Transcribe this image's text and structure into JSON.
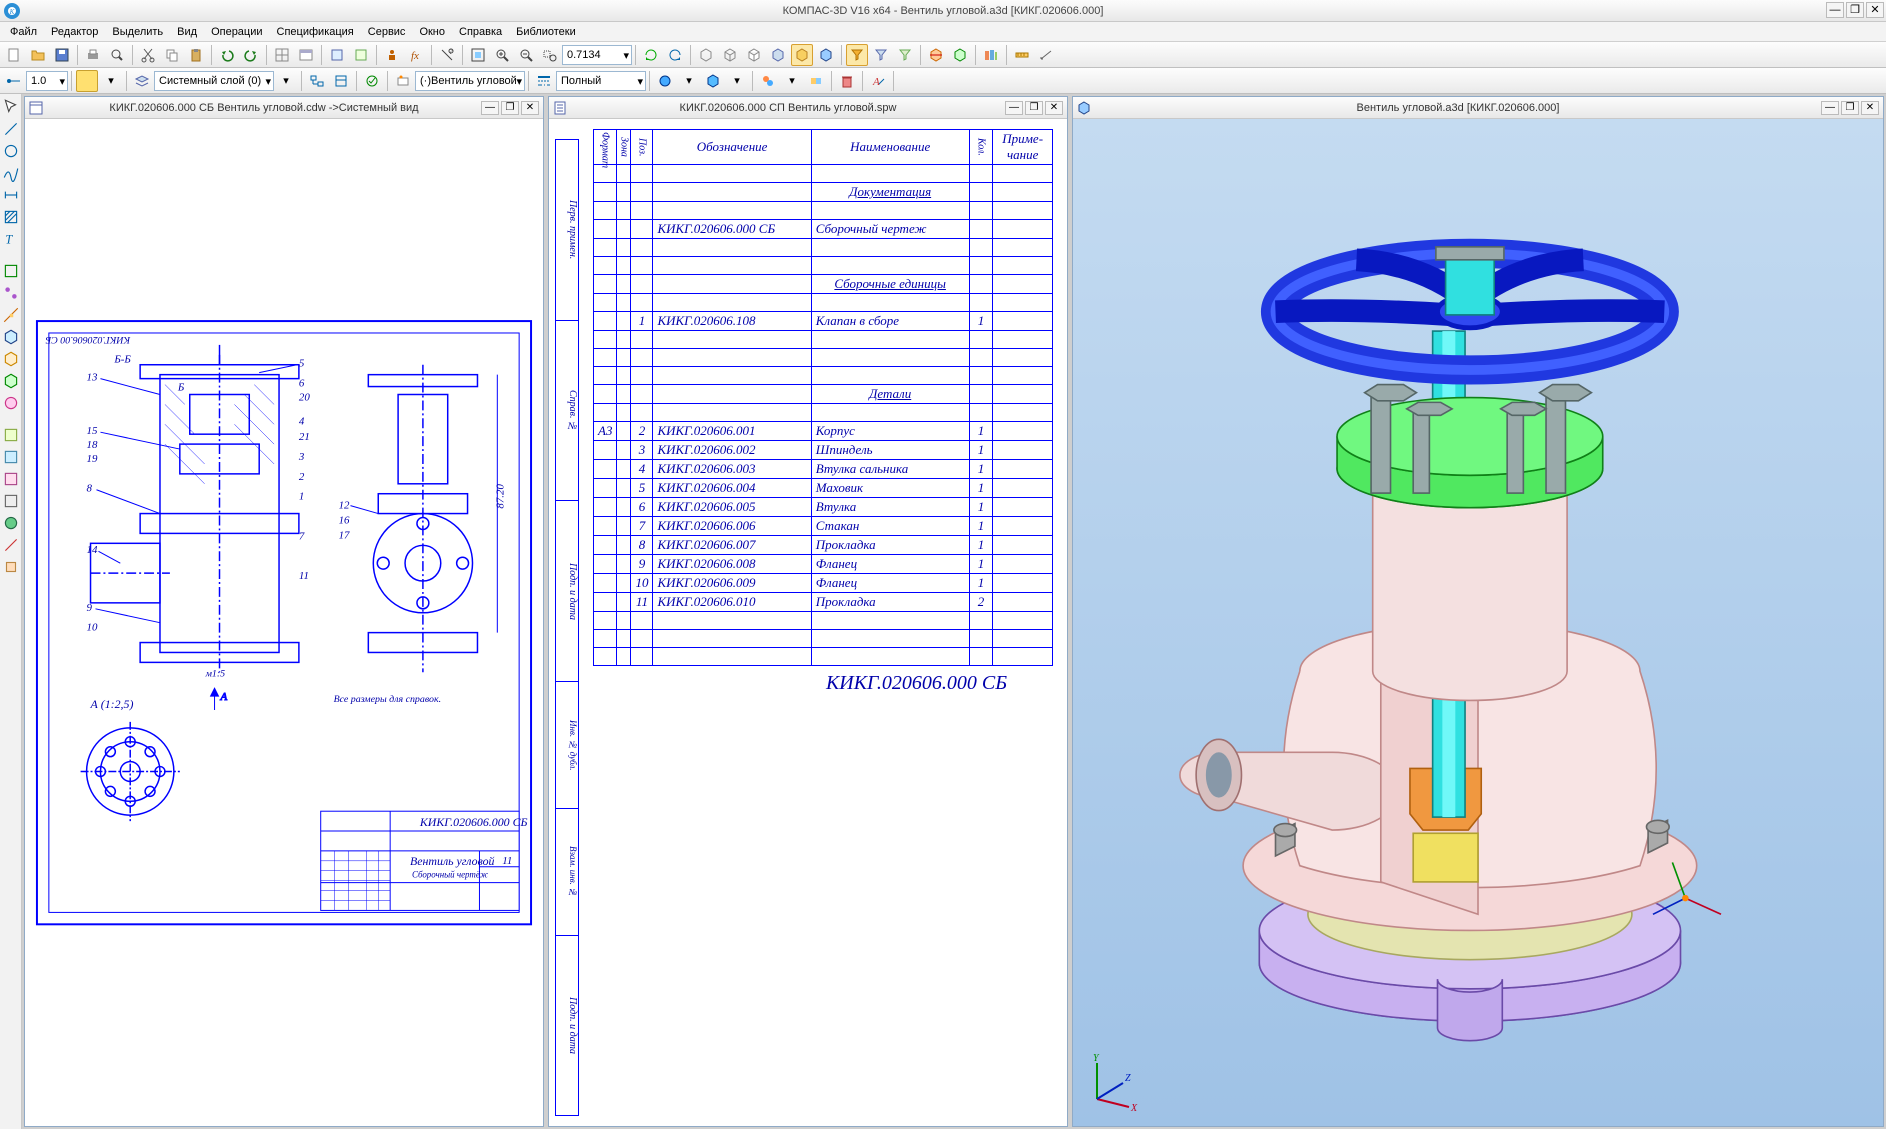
{
  "app_title": "КОМПАС-3D V16  x64 - Вентиль угловой.a3d [КИКГ.020606.000]",
  "menu": [
    "Файл",
    "Редактор",
    "Выделить",
    "Вид",
    "Операции",
    "Спецификация",
    "Сервис",
    "Окно",
    "Справка",
    "Библиотеки"
  ],
  "combo_zoom": "0.7134",
  "combo_width": "1.0",
  "combo_layer": "Системный слой (0)",
  "combo_view": "(·)Вентиль угловой",
  "combo_style": "Полный",
  "doc1_title": "КИКГ.020606.000 СБ Вентиль угловой.cdw ->Системный вид",
  "doc2_title": "КИКГ.020606.000 СП Вентиль  угловой.spw",
  "doc3_title": "Вентиль угловой.a3d [КИКГ.020606.000]",
  "dwg_code_top": "КИКГ.020606.00 СБ",
  "dwg_title_block_code": "КИКГ.020606.000 СБ",
  "dwg_title_block_name": "Вентиль угловой",
  "dwg_title_block_type": "Сборочный чертёж",
  "dwg_note": "Все размеры для справок.",
  "dwg_scale": "м1:5",
  "dwg_viewA": "А (1:2,5)",
  "dwg_sectBB": "Б-Б",
  "dwg_height_dim": "87.20",
  "dwg_page": "11",
  "spec_headers": {
    "c1": "Формат",
    "c2": "Зона",
    "c3": "Поз.",
    "c4": "Обозначение",
    "c5": "Наименование",
    "c6": "Кол.",
    "c7": "Приме-\nчание"
  },
  "spec_side_label": "Перв. примен.",
  "spec_side_label2": "Справ. №",
  "spec_side_label3": "Подп. и дата",
  "spec_side_label4": "Инв. № дубл.",
  "spec_side_label5": "Взам. инв. №",
  "spec_side_label6": "Подп. и дата",
  "spec_rows": [
    {
      "p": "",
      "d": "",
      "n": "",
      "k": ""
    },
    {
      "p": "",
      "d": "",
      "n": "Документация",
      "k": "",
      "centerN": true,
      "underline": true
    },
    {
      "p": "",
      "d": "",
      "n": "",
      "k": ""
    },
    {
      "p": "",
      "d": "КИКГ.020606.000 СБ",
      "n": "Сборочный чертеж",
      "k": ""
    },
    {
      "p": "",
      "d": "",
      "n": "",
      "k": ""
    },
    {
      "p": "",
      "d": "",
      "n": "",
      "k": ""
    },
    {
      "p": "",
      "d": "",
      "n": "Сборочные единицы",
      "k": "",
      "centerN": true,
      "underline": true
    },
    {
      "p": "",
      "d": "",
      "n": "",
      "k": ""
    },
    {
      "p": "1",
      "d": "КИКГ.020606.108",
      "n": "Клапан в сборе",
      "k": "1"
    },
    {
      "p": "",
      "d": "",
      "n": "",
      "k": ""
    },
    {
      "p": "",
      "d": "",
      "n": "",
      "k": ""
    },
    {
      "p": "",
      "d": "",
      "n": "",
      "k": ""
    },
    {
      "p": "",
      "d": "",
      "n": "Детали",
      "k": "",
      "centerN": true,
      "underline": true
    },
    {
      "p": "",
      "d": "",
      "n": "",
      "k": ""
    },
    {
      "p": "2",
      "d": "КИКГ.020606.001",
      "n": "Корпус",
      "k": "1",
      "f": "А3"
    },
    {
      "p": "3",
      "d": "КИКГ.020606.002",
      "n": "Шпиндель",
      "k": "1"
    },
    {
      "p": "4",
      "d": "КИКГ.020606.003",
      "n": "Втулка сальника",
      "k": "1"
    },
    {
      "p": "5",
      "d": "КИКГ.020606.004",
      "n": "Маховик",
      "k": "1"
    },
    {
      "p": "6",
      "d": "КИКГ.020606.005",
      "n": "Втулка",
      "k": "1"
    },
    {
      "p": "7",
      "d": "КИКГ.020606.006",
      "n": "Стакан",
      "k": "1"
    },
    {
      "p": "8",
      "d": "КИКГ.020606.007",
      "n": "Прокладка",
      "k": "1"
    },
    {
      "p": "9",
      "d": "КИКГ.020606.008",
      "n": "Фланец",
      "k": "1"
    },
    {
      "p": "10",
      "d": "КИКГ.020606.009",
      "n": "Фланец",
      "k": "1"
    },
    {
      "p": "11",
      "d": "КИКГ.020606.010",
      "n": "Прокладка",
      "k": "2"
    },
    {
      "p": "",
      "d": "",
      "n": "",
      "k": ""
    },
    {
      "p": "",
      "d": "",
      "n": "",
      "k": ""
    },
    {
      "p": "",
      "d": "",
      "n": "",
      "k": ""
    }
  ],
  "spec_bottom": "КИКГ.020606.000 СБ"
}
